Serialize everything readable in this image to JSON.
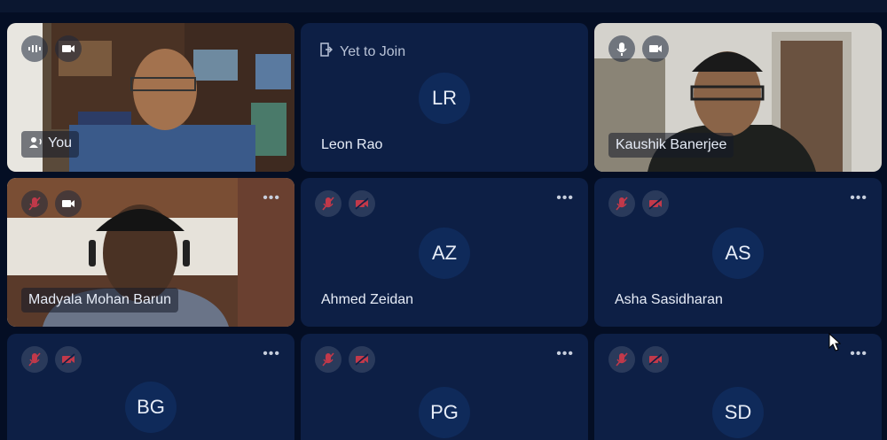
{
  "participants": [
    {
      "name": "You",
      "initials": "",
      "video": true,
      "mic": "active",
      "cam": "on",
      "self": true
    },
    {
      "name": "Leon Rao",
      "initials": "LR",
      "video": false,
      "status": "Yet to Join"
    },
    {
      "name": "Kaushik Banerjee",
      "initials": "",
      "video": true,
      "mic": "on",
      "cam": "on"
    },
    {
      "name": "Madyala Mohan Barun",
      "initials": "",
      "video": true,
      "mic": "muted",
      "cam": "on"
    },
    {
      "name": "Ahmed Zeidan",
      "initials": "AZ",
      "video": false,
      "mic": "muted",
      "cam": "off"
    },
    {
      "name": "Asha Sasidharan",
      "initials": "AS",
      "video": false,
      "mic": "muted",
      "cam": "off"
    },
    {
      "name": "",
      "initials": "BG",
      "video": false,
      "mic": "muted",
      "cam": "off"
    },
    {
      "name": "",
      "initials": "PG",
      "video": false,
      "mic": "muted",
      "cam": "off"
    },
    {
      "name": "",
      "initials": "SD",
      "video": false,
      "mic": "muted",
      "cam": "off"
    }
  ],
  "more_label": "•••",
  "icons": {
    "mic": "mic-icon",
    "mic_off": "mic-off-icon",
    "cam": "camera-icon",
    "cam_off": "camera-off-icon",
    "speaking": "speaking-icon",
    "leave": "exit-icon",
    "more": "more-options-icon",
    "cursor": "mouse-cursor-icon"
  },
  "colors": {
    "background": "#040e24",
    "tile": "#0d1f45",
    "avatar": "#0f2a5a",
    "muted_red": "#c2394a"
  }
}
